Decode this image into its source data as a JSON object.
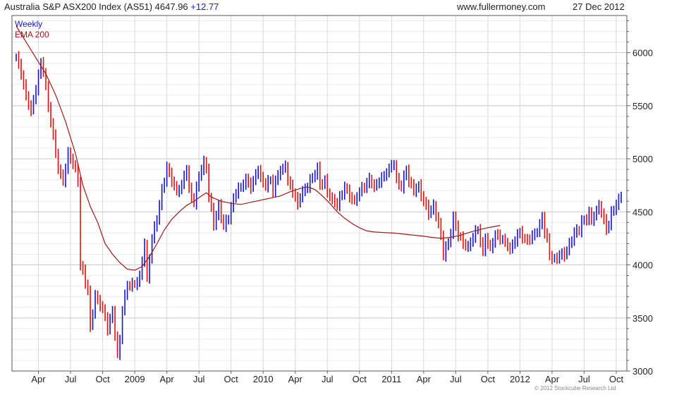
{
  "header": {
    "title": "Australia S&P ASX200 Index (AS51) 4647.96",
    "change": "+12.77",
    "site": "www.fullermoney.com",
    "date": "27 Dec 2012"
  },
  "copyright": "© 2012 Stockcube Research Ltd",
  "colors": {
    "up": "#1414d2",
    "down": "#e01010",
    "ema": "#a01818",
    "grid": "#d4d4d4",
    "frame": "#555555"
  },
  "chart_data": {
    "type": "line",
    "ylim": [
      3000,
      6350
    ],
    "y_ticks": [
      3000,
      3500,
      4000,
      4500,
      5000,
      5500,
      6000
    ],
    "x_ticks": [
      {
        "label": "Apr",
        "week": 9
      },
      {
        "label": "Jul",
        "week": 22
      },
      {
        "label": "Oct",
        "week": 35
      },
      {
        "label": "2009",
        "week": 48
      },
      {
        "label": "Apr",
        "week": 61
      },
      {
        "label": "Jul",
        "week": 74
      },
      {
        "label": "Oct",
        "week": 87
      },
      {
        "label": "2010",
        "week": 100
      },
      {
        "label": "Apr",
        "week": 113
      },
      {
        "label": "Jul",
        "week": 126
      },
      {
        "label": "Oct",
        "week": 139
      },
      {
        "label": "2011",
        "week": 152
      },
      {
        "label": "Apr",
        "week": 165
      },
      {
        "label": "Jul",
        "week": 178
      },
      {
        "label": "Oct",
        "week": 191
      },
      {
        "label": "2012",
        "week": 204
      },
      {
        "label": "Apr",
        "week": 217
      },
      {
        "label": "Jul",
        "week": 230
      },
      {
        "label": "Oct",
        "week": 243
      }
    ],
    "legend": [
      "Weekly",
      "EMA 200"
    ],
    "series": [
      {
        "name": "Weekly",
        "anchors": [
          [
            0,
            5950
          ],
          [
            2,
            5800
          ],
          [
            4,
            5600
          ],
          [
            6,
            5450
          ],
          [
            8,
            5650
          ],
          [
            10,
            5900
          ],
          [
            11,
            5850
          ],
          [
            13,
            5500
          ],
          [
            15,
            5200
          ],
          [
            17,
            4900
          ],
          [
            19,
            4800
          ],
          [
            21,
            5050
          ],
          [
            23,
            4950
          ],
          [
            25,
            4800
          ],
          [
            26,
            4000
          ],
          [
            27,
            3950
          ],
          [
            29,
            3750
          ],
          [
            30,
            3400
          ],
          [
            32,
            3700
          ],
          [
            35,
            3600
          ],
          [
            37,
            3400
          ],
          [
            39,
            3550
          ],
          [
            41,
            3150
          ],
          [
            42,
            3300
          ],
          [
            43,
            3600
          ],
          [
            45,
            3800
          ],
          [
            47,
            3800
          ],
          [
            49,
            3850
          ],
          [
            50,
            3900
          ],
          [
            52,
            4200
          ],
          [
            53,
            3850
          ],
          [
            55,
            4250
          ],
          [
            57,
            4450
          ],
          [
            59,
            4700
          ],
          [
            61,
            4900
          ],
          [
            63,
            4800
          ],
          [
            65,
            4700
          ],
          [
            67,
            4750
          ],
          [
            69,
            4900
          ],
          [
            70,
            4700
          ],
          [
            72,
            4600
          ],
          [
            74,
            4850
          ],
          [
            76,
            4950
          ],
          [
            77,
            4900
          ],
          [
            78,
            4650
          ],
          [
            80,
            4400
          ],
          [
            82,
            4550
          ],
          [
            84,
            4350
          ],
          [
            86,
            4450
          ],
          [
            87,
            4550
          ],
          [
            89,
            4700
          ],
          [
            91,
            4720
          ],
          [
            93,
            4800
          ],
          [
            95,
            4750
          ],
          [
            97,
            4850
          ],
          [
            98,
            4900
          ],
          [
            99,
            4800
          ],
          [
            101,
            4750
          ],
          [
            103,
            4820
          ],
          [
            104,
            4700
          ],
          [
            106,
            4850
          ],
          [
            108,
            4900
          ],
          [
            109,
            4950
          ],
          [
            110,
            4800
          ],
          [
            112,
            4700
          ],
          [
            114,
            4550
          ],
          [
            115,
            4650
          ],
          [
            117,
            4720
          ],
          [
            119,
            4800
          ],
          [
            121,
            4850
          ],
          [
            122,
            4900
          ],
          [
            123,
            4750
          ],
          [
            125,
            4800
          ],
          [
            126,
            4700
          ],
          [
            128,
            4600
          ],
          [
            130,
            4560
          ],
          [
            133,
            4750
          ],
          [
            135,
            4650
          ],
          [
            137,
            4580
          ],
          [
            139,
            4700
          ],
          [
            141,
            4750
          ],
          [
            143,
            4800
          ],
          [
            145,
            4720
          ],
          [
            147,
            4800
          ],
          [
            149,
            4850
          ],
          [
            151,
            4900
          ],
          [
            153,
            4950
          ],
          [
            154,
            4800
          ],
          [
            156,
            4750
          ],
          [
            158,
            4900
          ],
          [
            159,
            4780
          ],
          [
            161,
            4700
          ],
          [
            163,
            4750
          ],
          [
            165,
            4600
          ],
          [
            167,
            4480
          ],
          [
            169,
            4550
          ],
          [
            171,
            4400
          ],
          [
            172,
            4280
          ],
          [
            173,
            4100
          ],
          [
            175,
            4200
          ],
          [
            176,
            4300
          ],
          [
            177,
            4450
          ],
          [
            179,
            4300
          ],
          [
            181,
            4200
          ],
          [
            183,
            4150
          ],
          [
            185,
            4280
          ],
          [
            187,
            4350
          ],
          [
            189,
            4100
          ],
          [
            190,
            4250
          ],
          [
            192,
            4150
          ],
          [
            194,
            4300
          ],
          [
            196,
            4250
          ],
          [
            198,
            4200
          ],
          [
            200,
            4150
          ],
          [
            202,
            4250
          ],
          [
            204,
            4300
          ],
          [
            206,
            4220
          ],
          [
            208,
            4260
          ],
          [
            210,
            4300
          ],
          [
            212,
            4350
          ],
          [
            213,
            4450
          ],
          [
            214,
            4300
          ],
          [
            215,
            4250
          ],
          [
            216,
            4100
          ],
          [
            218,
            4050
          ],
          [
            220,
            4080
          ],
          [
            222,
            4100
          ],
          [
            223,
            4150
          ],
          [
            224,
            4200
          ],
          [
            226,
            4300
          ],
          [
            228,
            4320
          ],
          [
            229,
            4400
          ],
          [
            231,
            4450
          ],
          [
            232,
            4500
          ],
          [
            233,
            4420
          ],
          [
            235,
            4500
          ],
          [
            236,
            4550
          ],
          [
            237,
            4500
          ],
          [
            238,
            4420
          ],
          [
            239,
            4350
          ],
          [
            240,
            4400
          ],
          [
            241,
            4480
          ],
          [
            242,
            4520
          ],
          [
            243,
            4560
          ],
          [
            244,
            4600
          ],
          [
            245,
            4648
          ]
        ]
      },
      {
        "name": "EMA 200",
        "anchors": [
          [
            0,
            6250
          ],
          [
            4,
            6100
          ],
          [
            8,
            5950
          ],
          [
            12,
            5800
          ],
          [
            16,
            5600
          ],
          [
            20,
            5350
          ],
          [
            24,
            5050
          ],
          [
            27,
            4750
          ],
          [
            30,
            4550
          ],
          [
            33,
            4400
          ],
          [
            36,
            4200
          ],
          [
            39,
            4100
          ],
          [
            42,
            4020
          ],
          [
            45,
            3960
          ],
          [
            48,
            3950
          ],
          [
            51,
            3985
          ],
          [
            54,
            4080
          ],
          [
            57,
            4200
          ],
          [
            60,
            4330
          ],
          [
            63,
            4430
          ],
          [
            66,
            4500
          ],
          [
            69,
            4560
          ],
          [
            72,
            4600
          ],
          [
            75,
            4650
          ],
          [
            77,
            4680
          ],
          [
            79,
            4640
          ],
          [
            83,
            4600
          ],
          [
            87,
            4580
          ],
          [
            91,
            4570
          ],
          [
            95,
            4590
          ],
          [
            99,
            4610
          ],
          [
            103,
            4630
          ],
          [
            107,
            4650
          ],
          [
            111,
            4690
          ],
          [
            115,
            4720
          ],
          [
            118,
            4735
          ],
          [
            121,
            4710
          ],
          [
            124,
            4650
          ],
          [
            127,
            4580
          ],
          [
            130,
            4500
          ],
          [
            133,
            4440
          ],
          [
            136,
            4390
          ],
          [
            139,
            4350
          ],
          [
            142,
            4320
          ],
          [
            145,
            4310
          ],
          [
            149,
            4305
          ],
          [
            153,
            4300
          ],
          [
            157,
            4290
          ],
          [
            161,
            4280
          ],
          [
            165,
            4270
          ],
          [
            168,
            4260
          ],
          [
            172,
            4250
          ],
          [
            176,
            4260
          ],
          [
            180,
            4280
          ],
          [
            184,
            4310
          ],
          [
            188,
            4335
          ],
          [
            192,
            4355
          ],
          [
            196,
            4372
          ]
        ]
      }
    ],
    "last_value": 4647.96
  }
}
